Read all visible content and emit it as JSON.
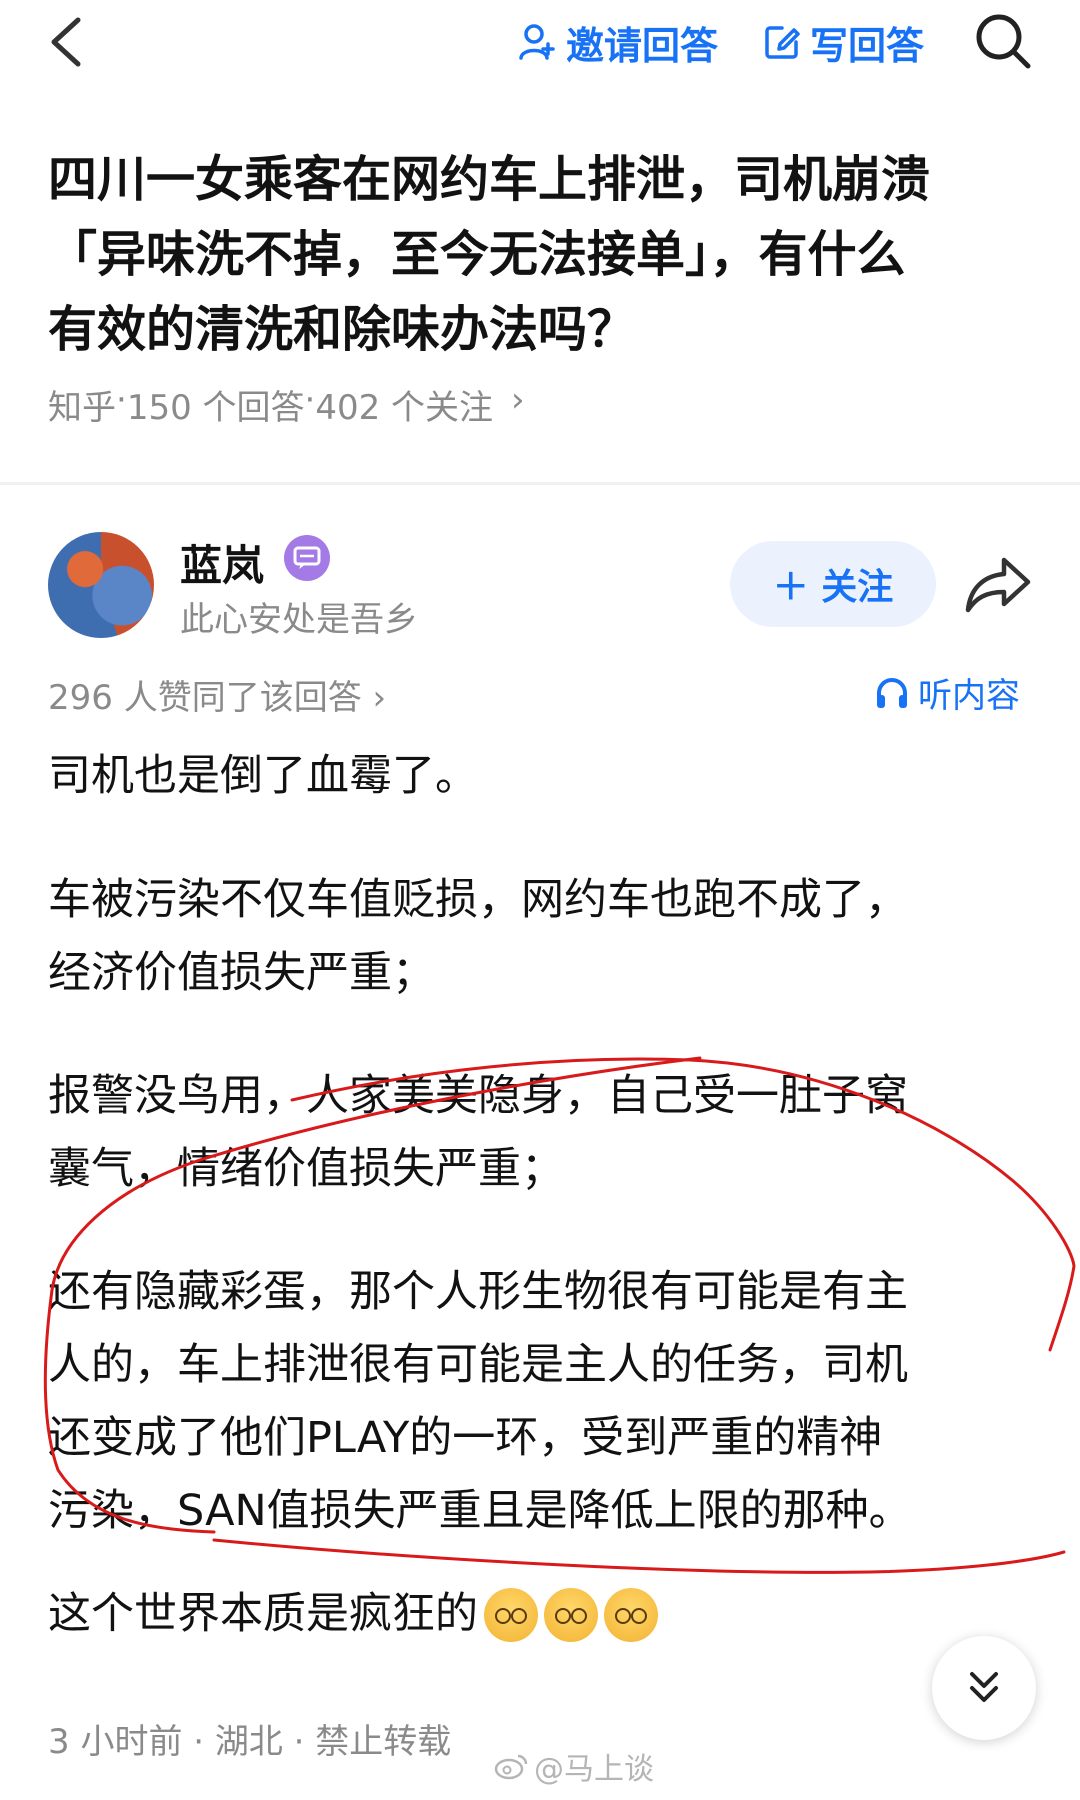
{
  "toolbar": {
    "invite_label": "邀请回答",
    "write_label": "写回答"
  },
  "question": {
    "title_line1": "四川一女乘客在网约车上排泄，司机崩溃",
    "title_line2": "「异味洗不掉，至今无法接单」，有什么",
    "title_line3": "有效的清洗和除味办法吗？",
    "source": "知乎",
    "answers": "150 个回答",
    "followers": "402 个关注",
    "sep": " · ",
    "chevron": "›"
  },
  "author": {
    "name": "蓝岚",
    "bio": "此心安处是吾乡",
    "follow_label": "＋ 关注"
  },
  "stats": {
    "votes": "296 人赞同了该回答 ›",
    "listen_label": "听内容"
  },
  "answer": {
    "p1": "司机也是倒了血霉了。",
    "p2_l1": "车被污染不仅车值贬损，网约车也跑不成了，",
    "p2_l2": "经济价值损失严重；",
    "p3_l1": "报警没鸟用，人家美美隐身，自己受一肚子窝",
    "p3_l2": "囊气，情绪价值损失严重；",
    "p4_l1": "还有隐藏彩蛋，那个人形生物很有可能是有主",
    "p4_l2": "人的，车上排泄很有可能是主人的任务，司机",
    "p4_l3": "还变成了他们PLAY的一环，受到严重的精神",
    "p4_l4": "污染，SAN值损失严重且是降低上限的那种。",
    "p5": "这个世界本质是疯狂的"
  },
  "footer": {
    "meta": "3 小时前 · 湖北 · 禁止转载",
    "watermark": "@马上谈"
  },
  "colors": {
    "accent": "#1772f6",
    "annotation": "#d91a1a",
    "muted": "#8a8a8a"
  }
}
